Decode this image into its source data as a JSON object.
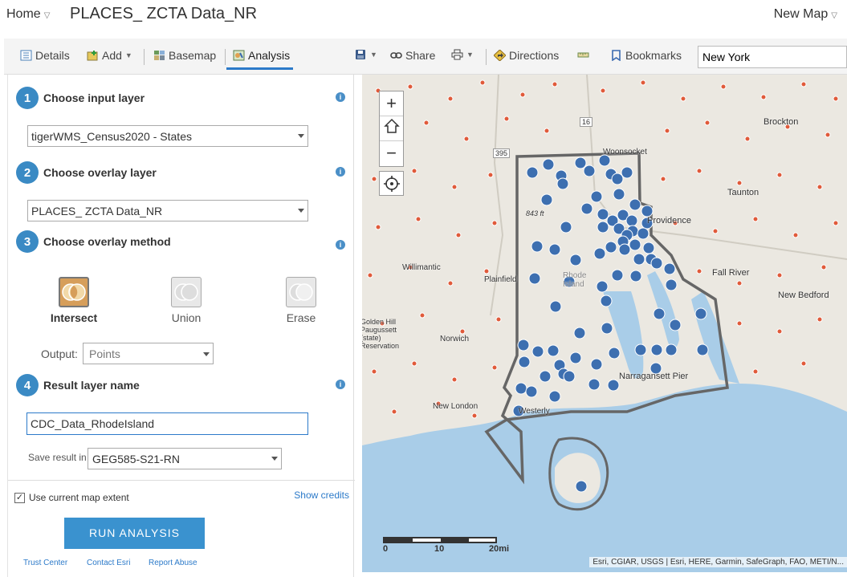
{
  "header": {
    "home": "Home",
    "title": "PLACES_ ZCTA Data_NR",
    "new_map": "New Map"
  },
  "toolbar": {
    "details": "Details",
    "add": "Add",
    "basemap": "Basemap",
    "analysis": "Analysis",
    "share": "Share",
    "directions": "Directions",
    "bookmarks": "Bookmarks",
    "search_value": "New York"
  },
  "panel": {
    "step1": {
      "num": "1",
      "title": "Choose input layer",
      "value": "tigerWMS_Census2020 - States"
    },
    "step2": {
      "num": "2",
      "title": "Choose overlay layer",
      "value": "PLACES_ ZCTA Data_NR"
    },
    "step3": {
      "num": "3",
      "title": "Choose overlay method",
      "methods": [
        "Intersect",
        "Union",
        "Erase"
      ],
      "selected": "Intersect",
      "output_label": "Output:",
      "output_value": "Points"
    },
    "step4": {
      "num": "4",
      "title": "Result layer name",
      "value": "CDC_Data_RhodeIsland",
      "save_label": "Save result in",
      "save_value": "GEG585-S21-RN"
    },
    "use_extent": "Use current map extent",
    "use_extent_checked": true,
    "show_credits": "Show credits",
    "run": "RUN ANALYSIS",
    "footer": [
      "Trust Center",
      "Contact Esri",
      "Report Abuse"
    ]
  },
  "map": {
    "attribution": "Esri, CGIAR, USGS | Esri, HERE, Garmin, SafeGraph, FAO, METI/N...",
    "scale": [
      "0",
      "10",
      "20mi"
    ],
    "places": [
      "Woonsocket",
      "Brockton",
      "Taunton",
      "Providence",
      "Fall River",
      "New Bedford",
      "Willimantic",
      "Plainfield",
      "Rhode Island",
      "Norwich",
      "Golden Hill Paugussett (state) Reservation",
      "New London",
      "Westerly",
      "Narragansett Pier",
      "843 ft",
      "16",
      "395"
    ],
    "colors": {
      "land": "#e9e6df",
      "water": "#a9cde8",
      "point": "#3d6fb0",
      "small_point": "#e05a3a",
      "outline": "#666666"
    }
  }
}
